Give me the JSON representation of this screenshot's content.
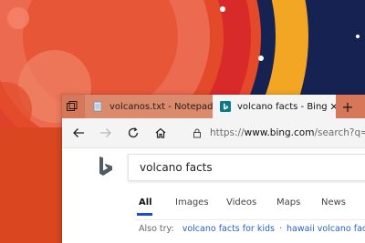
{
  "browser": {
    "tabs": [
      {
        "label": "volcanos.txt - Notepad",
        "icon": "notepad-icon",
        "active": false
      },
      {
        "label": "volcano facts - Bing",
        "icon": "bing-icon",
        "active": true
      }
    ],
    "tab_close_glyph": "✕",
    "new_tab_glyph": "+",
    "address": {
      "scheme": "https://",
      "domain": "www.bing.com",
      "path": "/search?q=volcano+f"
    },
    "nav_icons": [
      "back-arrow-icon",
      "forward-arrow-icon",
      "refresh-icon",
      "home-icon"
    ]
  },
  "search": {
    "query": "volcano facts",
    "scopes": [
      "All",
      "Images",
      "Videos",
      "Maps",
      "News"
    ],
    "active_scope": "All",
    "also_try_label": "Also try:",
    "also_try_links": [
      "volcano facts for kids",
      "hawaii volcano facts for kids"
    ],
    "also_try_separator": "·"
  },
  "colors": {
    "accent_scope": "#174ae4",
    "wallpaper_orange": "#e0502a",
    "wallpaper_navy": "#14214f",
    "tabbar": "#d7775a"
  }
}
